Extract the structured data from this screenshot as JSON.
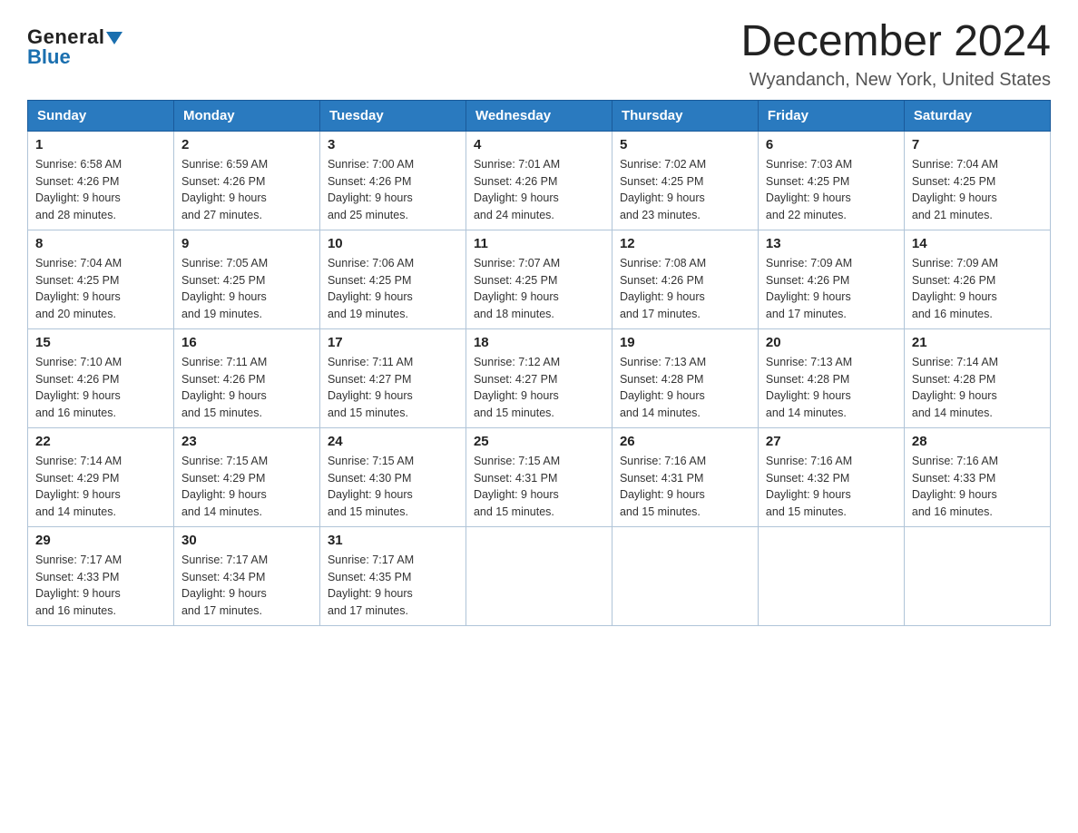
{
  "header": {
    "logo_general": "General",
    "logo_blue": "Blue",
    "month_title": "December 2024",
    "location": "Wyandanch, New York, United States"
  },
  "days_of_week": [
    "Sunday",
    "Monday",
    "Tuesday",
    "Wednesday",
    "Thursday",
    "Friday",
    "Saturday"
  ],
  "weeks": [
    [
      {
        "day": "1",
        "sunrise": "6:58 AM",
        "sunset": "4:26 PM",
        "daylight": "9 hours and 28 minutes."
      },
      {
        "day": "2",
        "sunrise": "6:59 AM",
        "sunset": "4:26 PM",
        "daylight": "9 hours and 27 minutes."
      },
      {
        "day": "3",
        "sunrise": "7:00 AM",
        "sunset": "4:26 PM",
        "daylight": "9 hours and 25 minutes."
      },
      {
        "day": "4",
        "sunrise": "7:01 AM",
        "sunset": "4:26 PM",
        "daylight": "9 hours and 24 minutes."
      },
      {
        "day": "5",
        "sunrise": "7:02 AM",
        "sunset": "4:25 PM",
        "daylight": "9 hours and 23 minutes."
      },
      {
        "day": "6",
        "sunrise": "7:03 AM",
        "sunset": "4:25 PM",
        "daylight": "9 hours and 22 minutes."
      },
      {
        "day": "7",
        "sunrise": "7:04 AM",
        "sunset": "4:25 PM",
        "daylight": "9 hours and 21 minutes."
      }
    ],
    [
      {
        "day": "8",
        "sunrise": "7:04 AM",
        "sunset": "4:25 PM",
        "daylight": "9 hours and 20 minutes."
      },
      {
        "day": "9",
        "sunrise": "7:05 AM",
        "sunset": "4:25 PM",
        "daylight": "9 hours and 19 minutes."
      },
      {
        "day": "10",
        "sunrise": "7:06 AM",
        "sunset": "4:25 PM",
        "daylight": "9 hours and 19 minutes."
      },
      {
        "day": "11",
        "sunrise": "7:07 AM",
        "sunset": "4:25 PM",
        "daylight": "9 hours and 18 minutes."
      },
      {
        "day": "12",
        "sunrise": "7:08 AM",
        "sunset": "4:26 PM",
        "daylight": "9 hours and 17 minutes."
      },
      {
        "day": "13",
        "sunrise": "7:09 AM",
        "sunset": "4:26 PM",
        "daylight": "9 hours and 17 minutes."
      },
      {
        "day": "14",
        "sunrise": "7:09 AM",
        "sunset": "4:26 PM",
        "daylight": "9 hours and 16 minutes."
      }
    ],
    [
      {
        "day": "15",
        "sunrise": "7:10 AM",
        "sunset": "4:26 PM",
        "daylight": "9 hours and 16 minutes."
      },
      {
        "day": "16",
        "sunrise": "7:11 AM",
        "sunset": "4:26 PM",
        "daylight": "9 hours and 15 minutes."
      },
      {
        "day": "17",
        "sunrise": "7:11 AM",
        "sunset": "4:27 PM",
        "daylight": "9 hours and 15 minutes."
      },
      {
        "day": "18",
        "sunrise": "7:12 AM",
        "sunset": "4:27 PM",
        "daylight": "9 hours and 15 minutes."
      },
      {
        "day": "19",
        "sunrise": "7:13 AM",
        "sunset": "4:28 PM",
        "daylight": "9 hours and 14 minutes."
      },
      {
        "day": "20",
        "sunrise": "7:13 AM",
        "sunset": "4:28 PM",
        "daylight": "9 hours and 14 minutes."
      },
      {
        "day": "21",
        "sunrise": "7:14 AM",
        "sunset": "4:28 PM",
        "daylight": "9 hours and 14 minutes."
      }
    ],
    [
      {
        "day": "22",
        "sunrise": "7:14 AM",
        "sunset": "4:29 PM",
        "daylight": "9 hours and 14 minutes."
      },
      {
        "day": "23",
        "sunrise": "7:15 AM",
        "sunset": "4:29 PM",
        "daylight": "9 hours and 14 minutes."
      },
      {
        "day": "24",
        "sunrise": "7:15 AM",
        "sunset": "4:30 PM",
        "daylight": "9 hours and 15 minutes."
      },
      {
        "day": "25",
        "sunrise": "7:15 AM",
        "sunset": "4:31 PM",
        "daylight": "9 hours and 15 minutes."
      },
      {
        "day": "26",
        "sunrise": "7:16 AM",
        "sunset": "4:31 PM",
        "daylight": "9 hours and 15 minutes."
      },
      {
        "day": "27",
        "sunrise": "7:16 AM",
        "sunset": "4:32 PM",
        "daylight": "9 hours and 15 minutes."
      },
      {
        "day": "28",
        "sunrise": "7:16 AM",
        "sunset": "4:33 PM",
        "daylight": "9 hours and 16 minutes."
      }
    ],
    [
      {
        "day": "29",
        "sunrise": "7:17 AM",
        "sunset": "4:33 PM",
        "daylight": "9 hours and 16 minutes."
      },
      {
        "day": "30",
        "sunrise": "7:17 AM",
        "sunset": "4:34 PM",
        "daylight": "9 hours and 17 minutes."
      },
      {
        "day": "31",
        "sunrise": "7:17 AM",
        "sunset": "4:35 PM",
        "daylight": "9 hours and 17 minutes."
      },
      null,
      null,
      null,
      null
    ]
  ],
  "labels": {
    "sunrise": "Sunrise:",
    "sunset": "Sunset:",
    "daylight": "Daylight:"
  }
}
